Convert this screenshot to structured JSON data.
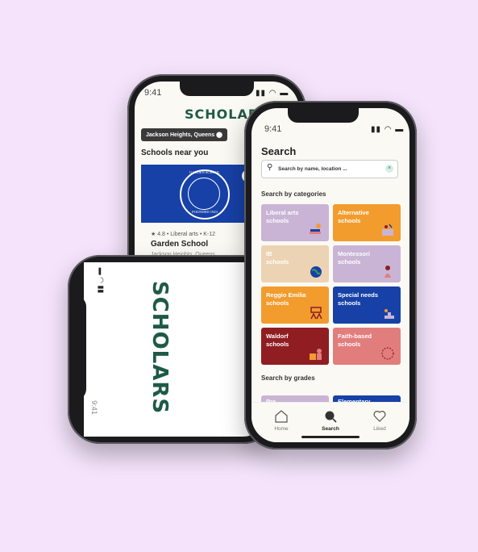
{
  "app_name": "SCHOLARS",
  "status": {
    "time": "9:41"
  },
  "back_screen": {
    "location": "Jackson Heights, Queens",
    "section_title": "Schools near you",
    "seal_top": "GARDEN SCHOOL",
    "seal_bottom": "FOUNDED 1923",
    "school": {
      "rating_line": "★ 4.8 • Liberal arts • K-12",
      "name": "Garden School",
      "address": "Jackson Heights, Queens"
    }
  },
  "search_screen": {
    "title": "Search",
    "search_placeholder": "Search by name, location ...",
    "categories_title": "Search by categories",
    "categories": [
      {
        "label": "Liberal arts\nschools",
        "color": "#c9b4d6"
      },
      {
        "label": "Alternative\nschools",
        "color": "#f29c2e"
      },
      {
        "label": "IB\nschools",
        "color": "#ecd3b4"
      },
      {
        "label": "Montessori\nschools",
        "color": "#c9b4d6"
      },
      {
        "label": "Reggio Emilia\nschools",
        "color": "#f29c2e"
      },
      {
        "label": "Special needs\nschools",
        "color": "#1741a7"
      },
      {
        "label": "Waldorf\nschools",
        "color": "#8f1d22"
      },
      {
        "label": "Faith-based\nschools",
        "color": "#e27d7d"
      }
    ],
    "grades_title": "Search by grades",
    "grades": [
      {
        "label": "Pre",
        "color": "#c9b4d6"
      },
      {
        "label": "Elementary",
        "color": "#1741a7"
      }
    ]
  },
  "tabbar": [
    {
      "label": "Home",
      "icon": "home-icon"
    },
    {
      "label": "Search",
      "icon": "search-icon",
      "active": true
    },
    {
      "label": "Liked",
      "icon": "heart-icon"
    }
  ]
}
